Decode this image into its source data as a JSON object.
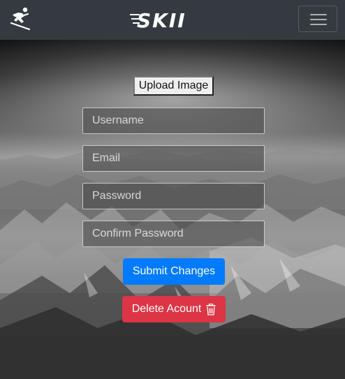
{
  "navbar": {
    "brand_icon": "skier-icon",
    "logo_text": "SKII",
    "toggler_icon": "hamburger-icon"
  },
  "form": {
    "upload_label": "Upload Image",
    "username_placeholder": "Username",
    "email_placeholder": "Email",
    "password_placeholder": "Password",
    "confirm_password_placeholder": "Confirm Password",
    "submit_label": "Submit Changes",
    "delete_label": "Delete Acount",
    "delete_icon": "trash-icon"
  },
  "colors": {
    "navbar": "#343a40",
    "primary": "#007bff",
    "danger": "#dc3545"
  }
}
